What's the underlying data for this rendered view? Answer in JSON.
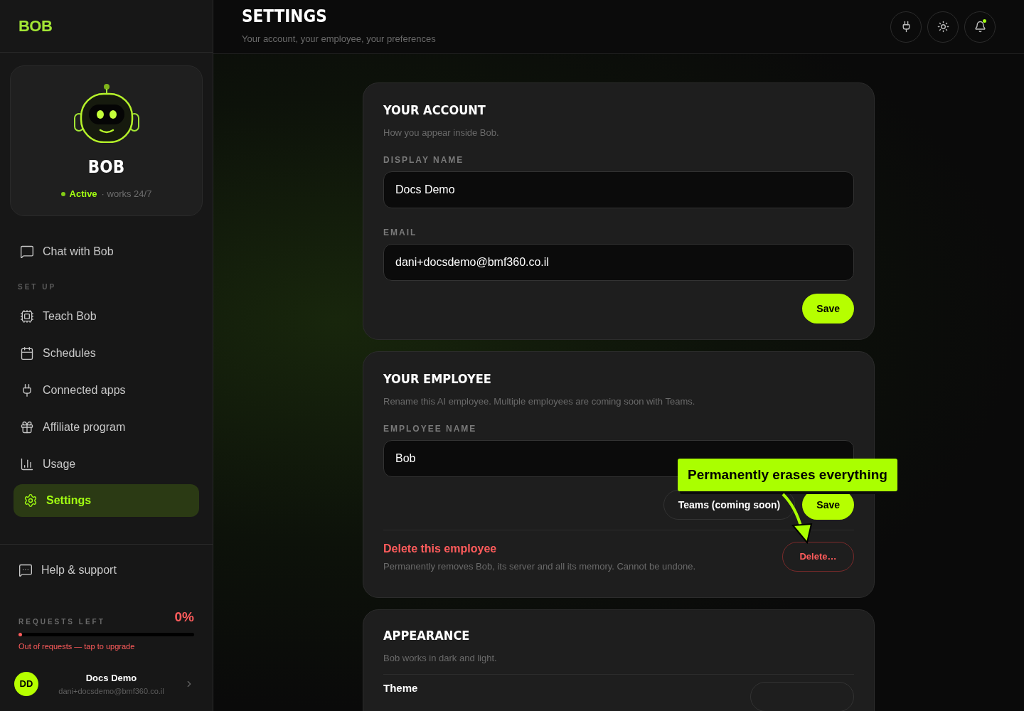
{
  "sidebar": {
    "logo": "BOB",
    "profile": {
      "name": "BOB",
      "status": "Active",
      "note": "· works 24/7"
    },
    "items": [
      {
        "kind": "chat",
        "label": "Chat with Bob",
        "selected": false
      }
    ],
    "section_label": "SET UP",
    "setup_items": [
      {
        "kind": "chip",
        "label": "Teach Bob",
        "selected": false
      },
      {
        "kind": "calendar",
        "label": "Schedules",
        "selected": false
      },
      {
        "kind": "plug",
        "label": "Connected apps",
        "selected": false
      },
      {
        "kind": "gift",
        "label": "Affiliate program",
        "selected": false
      },
      {
        "kind": "chart",
        "label": "Usage",
        "selected": false
      },
      {
        "kind": "gear",
        "label": "Settings",
        "selected": true
      }
    ],
    "help": {
      "label": "Help & support"
    },
    "requests": {
      "label": "REQUESTS LEFT",
      "reading": "0%",
      "level": 0,
      "warning": "Out of requests — tap to upgrade"
    },
    "user": {
      "initials": "DD",
      "name": "Docs Demo",
      "email": "dani+docsdemo@bmf360.co.il"
    }
  },
  "header": {
    "title": "SETTINGS",
    "subtitle": "Your account, your employee, your preferences",
    "notification": true
  },
  "account": {
    "title": "YOUR ACCOUNT",
    "description": "How you appear inside Bob.",
    "fields": [
      {
        "label": "DISPLAY NAME",
        "value": "Docs Demo"
      },
      {
        "label": "EMAIL",
        "value": "dani+docsdemo@bmf360.co.il"
      }
    ],
    "save": "Save"
  },
  "employee": {
    "title": "YOUR EMPLOYEE",
    "description": "Rename this AI employee. Multiple employees are coming soon with Teams.",
    "field": {
      "label": "EMPLOYEE NAME",
      "value": "Bob"
    },
    "teams_button": "Teams (coming soon)",
    "save": "Save",
    "delete": {
      "title": "Delete this employee",
      "description": "Permanently removes Bob, its server and all its memory. Cannot be undone.",
      "button": "Delete…"
    },
    "callout": "Permanently erases everything"
  },
  "appearance": {
    "title": "APPEARANCE",
    "description": "Bob works in dark and light.",
    "row_label": "Theme"
  }
}
